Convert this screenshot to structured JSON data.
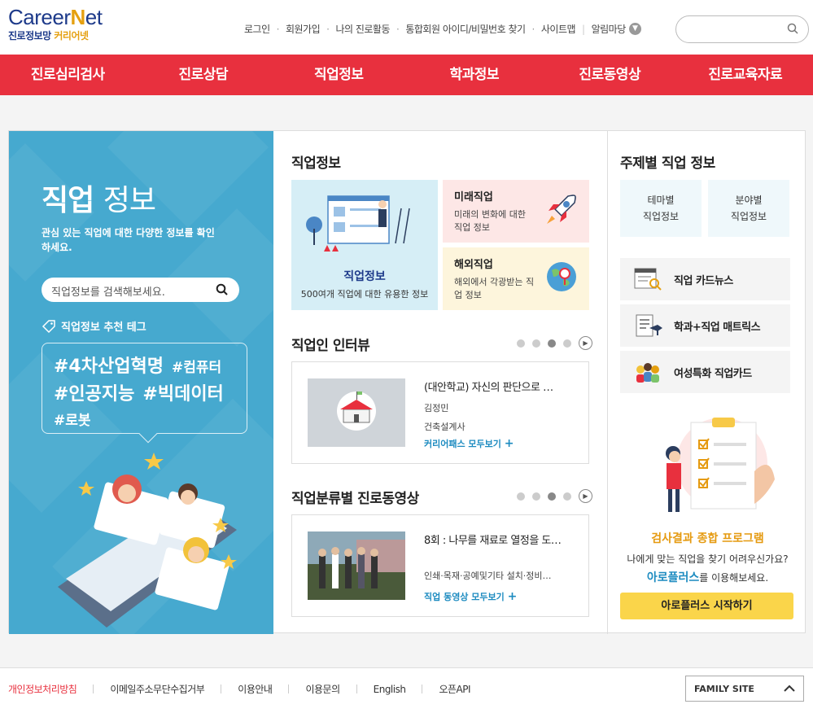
{
  "logo": {
    "brand_a": "Career",
    "brand_n": "N",
    "brand_b": "et",
    "sub_a": "진로정보망",
    "sub_b": "커리어넷"
  },
  "topnav": {
    "items": [
      "로그인",
      "회원가입",
      "나의 진로활동",
      "통합회원 아이디/비밀번호 찾기",
      "사이트맵"
    ],
    "notice": "알림마당"
  },
  "gnb": [
    "진로심리검사",
    "진로상담",
    "직업정보",
    "학과정보",
    "진로동영상",
    "진로교육자료"
  ],
  "left": {
    "title_bold": "직업",
    "title_light": "정보",
    "desc": "관심 있는 직업에 대한 다양한 정보를 확인하세요.",
    "search_placeholder": "직업정보를 검색해보세요.",
    "tag_title": "직업정보 추천 테그",
    "tags": [
      "#4차산업혁명",
      "#컴퓨터",
      "#인공지능",
      "#빅데이터",
      "#로봇"
    ]
  },
  "jobinfo": {
    "title": "직업정보",
    "big": {
      "title": "직업정보",
      "desc": "500여개 직업에 대한 유용한 정보"
    },
    "future": {
      "title": "미래직업",
      "desc": "미래의 변화에 대한 직업 정보"
    },
    "overseas": {
      "title": "해외직업",
      "desc": "해외에서 각광받는 직업 정보"
    }
  },
  "interview": {
    "title": "직업인 인터뷰",
    "item_title": "(대안학교) 자신의 판단으로 …",
    "name": "김정민",
    "job": "건축설계사",
    "more": "커리어패스 모두보기"
  },
  "video": {
    "title": "직업분류별 진로동영상",
    "item_title": "8회 : 나무를 재료로 열정을 도…",
    "category": "인쇄·목재·공예및기타 설치·정비…",
    "more": "직업 동영상 모두보기"
  },
  "right": {
    "title": "주제별 직업 정보",
    "theme": {
      "a1": "테마별",
      "a2": "직업정보",
      "b1": "분야별",
      "b2": "직업정보"
    },
    "list": [
      "직업 카드뉴스",
      "학과+직업 매트릭스",
      "여성특화 직업카드"
    ],
    "ap_title": "검사결과 종합 프로그램",
    "ap_desc1": "나에게 맞는 직업을 찾기 어려우신가요?",
    "ap_hl": "아로플러스",
    "ap_desc2": "를 이용해보세요.",
    "ap_btn": "아로플러스 시작하기"
  },
  "footer": {
    "items": [
      "개인정보처리방침",
      "이메일주소무단수집거부",
      "이용안내",
      "이용문의",
      "English",
      "오픈API"
    ],
    "family": "FAMILY SITE"
  },
  "colors": {
    "primary_red": "#e8303e",
    "panel_blue": "#46a9cf",
    "accent_yellow": "#fad54a",
    "link_blue": "#1c8bc0"
  }
}
